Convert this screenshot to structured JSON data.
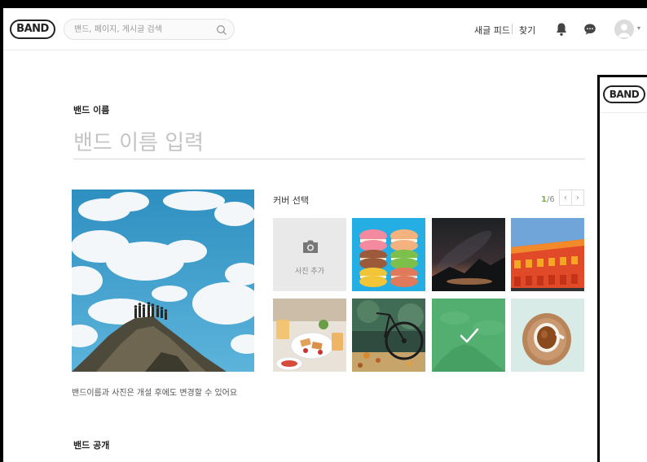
{
  "header": {
    "logo": "BAND",
    "search_placeholder": "밴드, 페이지, 게시글 검색",
    "nav_feed": "새글 피드",
    "nav_find": "찾기"
  },
  "form": {
    "name_label": "밴드 이름",
    "name_placeholder": "밴드 이름 입력",
    "caption": "밴드이름과 사진은 개설 후에도 변경할 수 있어요",
    "open_label": "밴드 공개"
  },
  "cover": {
    "title": "커버 선택",
    "page_current": "1",
    "page_total": "/6",
    "prev": "‹",
    "next": "›",
    "add_photo": "사진 추가",
    "selected_index": 6,
    "thumbnails": [
      "add-photo",
      "macarons",
      "night-sky",
      "red-building",
      "breakfast",
      "bicycle",
      "mountain-green",
      "coffee-cup"
    ]
  },
  "side_panel": {
    "logo": "BAND"
  },
  "colors": {
    "accent": "#7cb342",
    "selected_overlay": "#4caf6a"
  }
}
